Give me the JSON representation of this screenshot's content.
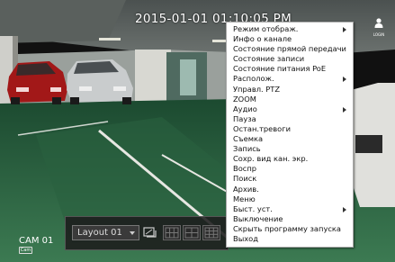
{
  "overlay": {
    "datetime": "2015-01-01 01:10:05 PM",
    "login_label": "LOGIN",
    "camera_label": "CAM 01",
    "camera_badge": "Cam"
  },
  "toolbar": {
    "layout_value": "Layout 01"
  },
  "context_menu": {
    "items": [
      {
        "label": "Режим отображ.",
        "has_submenu": true
      },
      {
        "label": "Инфо о канале",
        "has_submenu": false
      },
      {
        "label": "Состояние прямой передачи",
        "has_submenu": false
      },
      {
        "label": "Состояние записи",
        "has_submenu": false
      },
      {
        "label": "Состояние питания PoE",
        "has_submenu": false
      },
      {
        "label": "Располож.",
        "has_submenu": true
      },
      {
        "label": "Управл. PTZ",
        "has_submenu": false
      },
      {
        "label": "ZOOM",
        "has_submenu": false
      },
      {
        "label": "Аудио",
        "has_submenu": true
      },
      {
        "label": "Пауза",
        "has_submenu": false
      },
      {
        "label": "Остан.тревоги",
        "has_submenu": false
      },
      {
        "label": "Съемка",
        "has_submenu": false
      },
      {
        "label": "Запись",
        "has_submenu": false
      },
      {
        "label": "Сохр. вид кан. экр.",
        "has_submenu": false
      },
      {
        "label": "Воспр",
        "has_submenu": false
      },
      {
        "label": "Поиск",
        "has_submenu": false
      },
      {
        "label": "Архив.",
        "has_submenu": false
      },
      {
        "label": "Меню",
        "has_submenu": false
      },
      {
        "label": "Быст. уст.",
        "has_submenu": true
      },
      {
        "label": "Выключение",
        "has_submenu": false
      },
      {
        "label": "Скрыть программу запуска",
        "has_submenu": false
      },
      {
        "label": "Выход",
        "has_submenu": false
      }
    ]
  }
}
